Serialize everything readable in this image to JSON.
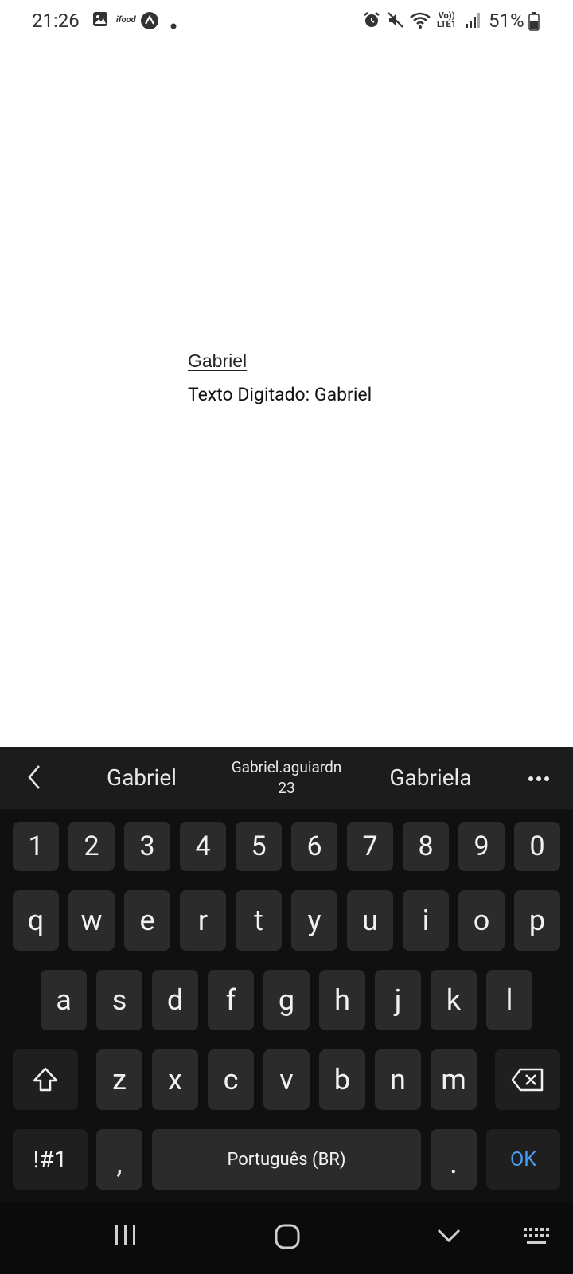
{
  "status_bar": {
    "time": "21:26",
    "app_label": "ifood",
    "signal_label": "Vo)) LTE1",
    "battery": "51%"
  },
  "content": {
    "input_value": "Gabriel",
    "label_text": "Texto Digitado: Gabriel"
  },
  "keyboard": {
    "suggestions": [
      "Gabriel",
      "Gabriel.aguiardn",
      "23",
      "Gabriela"
    ],
    "number_row": [
      "1",
      "2",
      "3",
      "4",
      "5",
      "6",
      "7",
      "8",
      "9",
      "0"
    ],
    "row1": [
      "q",
      "w",
      "e",
      "r",
      "t",
      "y",
      "u",
      "i",
      "o",
      "p"
    ],
    "row2": [
      "a",
      "s",
      "d",
      "f",
      "g",
      "h",
      "j",
      "k",
      "l"
    ],
    "row3": [
      "z",
      "x",
      "c",
      "v",
      "b",
      "n",
      "m"
    ],
    "symbols_label": "!#1",
    "comma": ",",
    "space_label": "Português (BR)",
    "period": ".",
    "ok_label": "OK",
    "accent_color": "#4a9ff5"
  }
}
